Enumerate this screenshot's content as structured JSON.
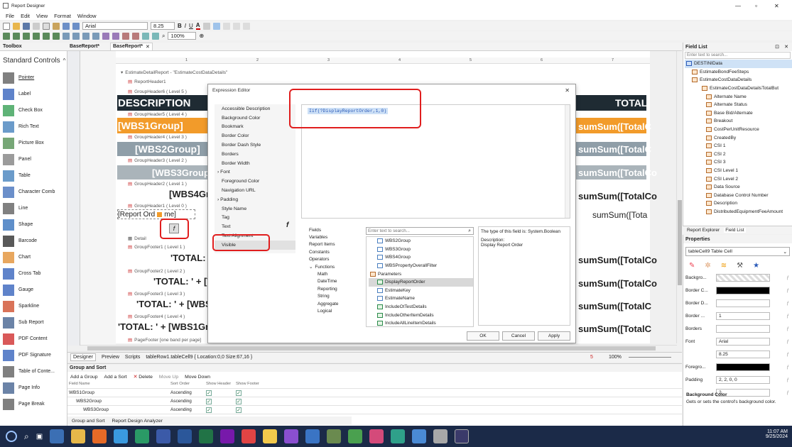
{
  "title_bar": {
    "title": "Report Designer",
    "min": "—",
    "max": "▫",
    "close": "✕"
  },
  "menu": [
    "File",
    "Edit",
    "View",
    "Format",
    "Window"
  ],
  "toolbar": {
    "font_name": "Arial",
    "font_size": "8.25",
    "zoom": "100%"
  },
  "tabs": {
    "toolbox": "Toolbox",
    "base_report_1": "BaseReport*",
    "base_report_2": "BaseReport*",
    "close": "✕"
  },
  "toolbox": {
    "header": "Standard Controls",
    "items": [
      "Pointer",
      "Label",
      "Check Box",
      "Rich Text",
      "Picture Box",
      "Panel",
      "Table",
      "Character Comb",
      "Line",
      "Shape",
      "Barcode",
      "Chart",
      "Cross Tab",
      "Gauge",
      "Sparkline",
      "Sub Report",
      "PDF Content",
      "PDF Signature",
      "Table of Conte...",
      "Page Info",
      "Page Break"
    ]
  },
  "ruler": [
    "1",
    "2",
    "3",
    "4",
    "5",
    "6",
    "7"
  ],
  "bands": [
    "EstimateDetailReport - \"EstimateCostDataDetails\"",
    "ReportHeader1",
    "GroupHeader6 ( Level 5 )",
    "GroupHeader5 ( Level 4 )",
    "GroupHeader4 ( Level 3 )",
    "GroupHeader3 ( Level 2 )",
    "GroupHeader2 ( Level 1 )",
    "GroupHeader1 ( Level 0 )",
    "Detail",
    "GroupFooter1 ( Level 1 )",
    "GroupFooter2 ( Level 2 )",
    "GroupFooter3 ( Level 3 )",
    "GroupFooter4 ( Level 4 )",
    "PageFooter [one band per page]"
  ],
  "report_cells": {
    "description": "DESCRIPTION",
    "total": "TOTAL",
    "wbs1": "[WBS1Group]",
    "wbs2": "[WBS2Group]",
    "wbs3": "[WBS3Group]",
    "wbs4": "[WBS4Gr",
    "report_ord": "[Report Ord",
    "name_frag": "me]",
    "sum1": "sumSum([TotalC",
    "sum2": "sumSum([TotalC",
    "sum3": "sumSum([TotalCo",
    "sum4": "sumSum([TotalCo",
    "sum5": "sumSum([Tota",
    "sum6": "sumSum([TotalCo",
    "sum7": "sumSum([TotalCo",
    "sum8": "sumSum([TotalC",
    "sum9": "sumSum([TotalC",
    "total_f1": "'TOTAL: '",
    "total_f2": "'TOTAL: ' + [W",
    "total_f3": "'TOTAL: ' + [WBS",
    "total_f4": "'TOTAL: ' + [WBS1Gr",
    "fx": "f"
  },
  "expression_editor": {
    "title": "Expression Editor",
    "close": "✕",
    "properties": [
      "Accessible Description",
      "Background Color",
      "Bookmark",
      "Border Color",
      "Border Dash Style",
      "Borders",
      "Border Width",
      "Font",
      "Foreground Color",
      "Navigation URL",
      "Padding",
      "Style Name",
      "Tag",
      "Text",
      "Text Alignment",
      "Visible"
    ],
    "expression": "Iif(?DisplayReportOrder,1,0)",
    "categories": [
      "Fields",
      "Variables",
      "Report Items",
      "Constants",
      "Operators",
      "Functions",
      "Math",
      "DateTime",
      "Reporting",
      "String",
      "Aggregate",
      "Logical"
    ],
    "search_placeholder": "Enter text to search...",
    "field_items": [
      "WBS2Group",
      "WBS3Group",
      "WBS4Group",
      "WBSPropertyOverallFilter",
      "Parameters",
      "DisplayReportOrder",
      "EstimateKey",
      "EstimateName",
      "IncludeOtTestDetails",
      "IncludeOtherItemDetails",
      "IncludeAllLineItemDetails"
    ],
    "desc_type": "The type of this field is: System.Boolean",
    "desc_label": "Description:",
    "desc_text": "Display Report Order",
    "ok": "OK",
    "cancel": "Cancel",
    "apply": "Apply"
  },
  "bottom_tabs": {
    "designer": "Designer",
    "preview": "Preview",
    "scripts": "Scripts",
    "status": "tableRow1.tableCell9 { Location:0,0 Size:67,16 }",
    "zoom_val": "100%",
    "pin": "5"
  },
  "group_sort": {
    "header": "Group and Sort",
    "add_group": "Add a Group",
    "add_sort": "Add a Sort",
    "delete": "Delete",
    "move_up": "Move Up",
    "move_down": "Move Down",
    "cols": [
      "Field Name",
      "Sort Order",
      "Show Header",
      "Show Footer"
    ],
    "rows": [
      {
        "name": "WBS1Group",
        "order": "Ascending"
      },
      {
        "name": "WBS2Group",
        "order": "Ascending"
      },
      {
        "name": "WBS3Group",
        "order": "Ascending"
      }
    ],
    "bottom_tab1": "Group and Sort",
    "bottom_tab2": "Report Design Analyzer"
  },
  "field_list": {
    "header": "Field List",
    "search_placeholder": "Enter text to search...",
    "items": [
      "DESTINIData",
      "EstimateBondFeeSteps",
      "EstimateCostDataDetails",
      "EstimateCostDataDetailsTotalBut",
      "Alternate Name",
      "Alternate Status",
      "Base Bid/Alternate",
      "Breakout",
      "CostPerUnitResource",
      "CreatedBy",
      "CSI 1",
      "CSI 2",
      "CSI 3",
      "CSI Level 1",
      "CSI Level 2",
      "Data Source",
      "Database Control Number",
      "Description",
      "DistributedEquipmentFeeAmount"
    ],
    "tab1": "Report Explorer",
    "tab2": "Field List"
  },
  "properties": {
    "header": "Properties",
    "selector": "tableCell9 Table Cell",
    "rows": [
      {
        "label": "Backgro..."
      },
      {
        "label": "Border C..."
      },
      {
        "label": "Border D..."
      },
      {
        "label": "Border ...",
        "value": "1"
      },
      {
        "label": "Borders"
      },
      {
        "label": "Font",
        "value": "Arial"
      },
      {
        "label": "",
        "value": "8.25"
      },
      {
        "label": "Foregro..."
      },
      {
        "label": "Padding",
        "value": "2, 2, 0, 0"
      },
      {
        "label": "",
        "value": "2"
      }
    ],
    "desc_title": "Background Color",
    "desc_text": "Gets or sets the control's background color."
  },
  "taskbar": {
    "time": "11:07 AM",
    "date": "9/25/2024"
  },
  "colors": {
    "accent_red": "#e01e1e",
    "dark_band": "#1f2b33",
    "orange": "#f29b2a",
    "gray_band": "#8f9ea8",
    "light_gray": "#aab4ba"
  }
}
